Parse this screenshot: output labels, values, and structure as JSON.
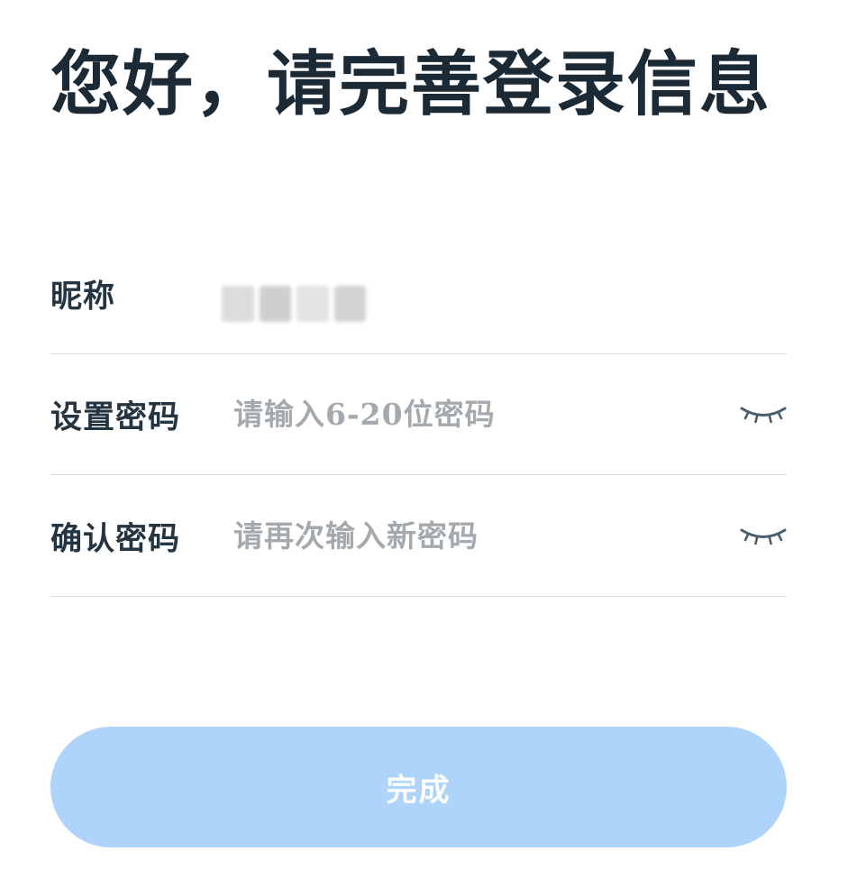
{
  "header": {
    "title": "您好，请完善登录信息"
  },
  "form": {
    "nickname": {
      "label": "昵称",
      "value_obscured": true
    },
    "password": {
      "label": "设置密码",
      "placeholder": "请输入6-20位密码",
      "value": "",
      "toggle_icon": "eye-closed-icon"
    },
    "confirm_password": {
      "label": "确认密码",
      "placeholder": "请再次输入新密码",
      "value": "",
      "toggle_icon": "eye-closed-icon"
    }
  },
  "actions": {
    "done_label": "完成"
  },
  "colors": {
    "title": "#1c2a36",
    "label": "#243440",
    "placeholder": "#a4a9ad",
    "divider": "#d9dee2",
    "button_bg": "#afd4fb",
    "button_text": "#ffffff",
    "icon": "#4b5f6b"
  }
}
